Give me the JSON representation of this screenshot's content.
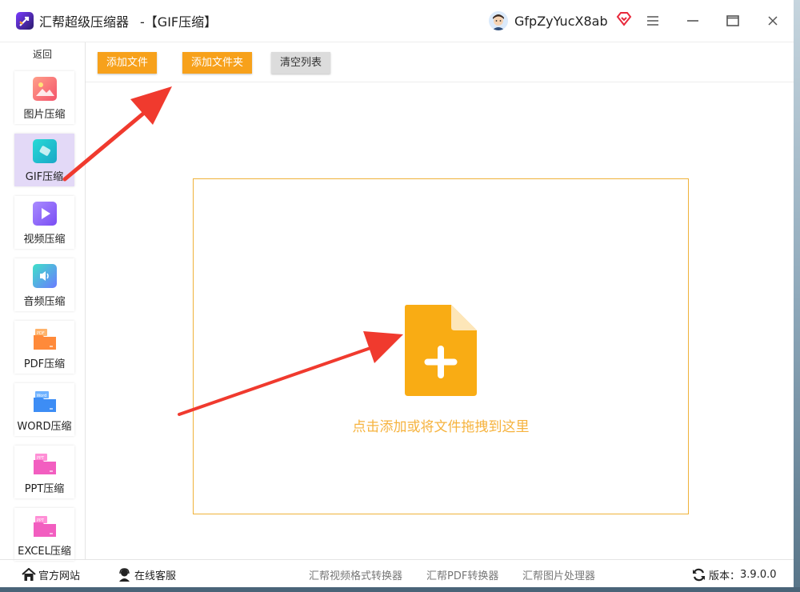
{
  "app": {
    "title": "汇帮超级压缩器",
    "page_title": "-【GIF压缩】",
    "username": "GfpZyYucX8ab"
  },
  "sidebar": {
    "back_label": "返回",
    "items": [
      {
        "label": "图片压缩",
        "icon": "image-icon"
      },
      {
        "label": "GIF压缩",
        "icon": "gif-icon",
        "active": true
      },
      {
        "label": "视频压缩",
        "icon": "video-play-icon"
      },
      {
        "label": "音频压缩",
        "icon": "audio-speaker-icon"
      },
      {
        "label": "PDF压缩",
        "icon": "pdf-folder-icon"
      },
      {
        "label": "WORD压缩",
        "icon": "word-folder-icon"
      },
      {
        "label": "PPT压缩",
        "icon": "ppt-folder-icon"
      },
      {
        "label": "EXCEL压缩",
        "icon": "excel-folder-icon"
      }
    ]
  },
  "toolbar": {
    "add_file": "添加文件",
    "add_folder": "添加文件夹",
    "clear_list": "清空列表"
  },
  "dropzone": {
    "hint": "点击添加或将文件拖拽到这里"
  },
  "statusbar": {
    "website": "官方网站",
    "support": "在线客服",
    "link_video": "汇帮视频格式转换器",
    "link_pdf": "汇帮PDF转换器",
    "link_image": "汇帮图片处理器",
    "version_label": "版本：",
    "version": "3.9.0.0"
  },
  "colors": {
    "accent": "#f7a11b",
    "drop_icon": "#f9ac14",
    "hint_text": "#f6b33e",
    "active_nav": "#e3d9f7",
    "annotation_arrow": "#f03a2e"
  }
}
